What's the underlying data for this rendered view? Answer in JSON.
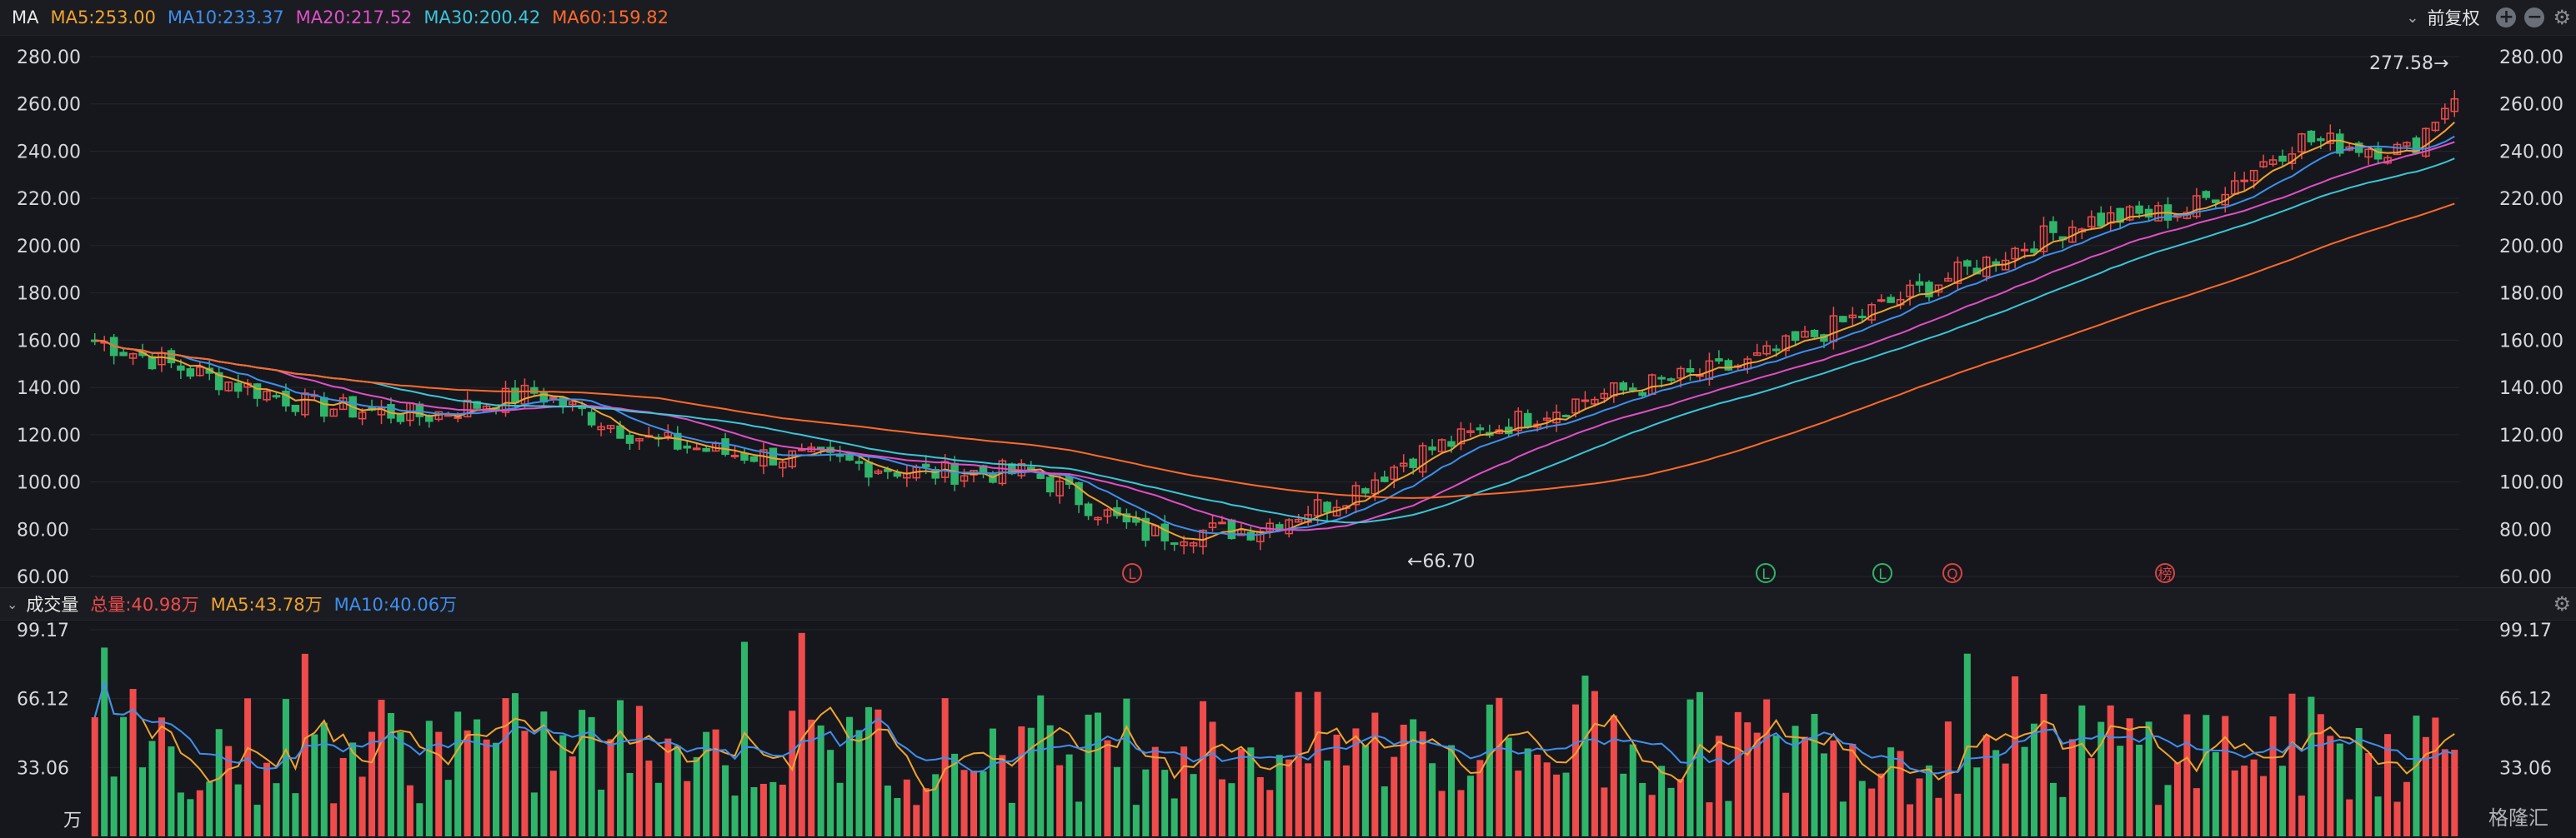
{
  "header": {
    "indicator": "MA",
    "ma": [
      {
        "label": "MA5:253.00",
        "color": "#f0a330"
      },
      {
        "label": "MA10:233.37",
        "color": "#3d8ff0"
      },
      {
        "label": "MA20:217.52",
        "color": "#e04fc8"
      },
      {
        "label": "MA30:200.42",
        "color": "#3bc5d9"
      },
      {
        "label": "MA60:159.82",
        "color": "#ff6a2a"
      }
    ],
    "adjust_label": "前复权",
    "chevron": "chevron-down-icon",
    "plus": "plus-circle-icon",
    "minus": "minus-circle-icon",
    "settings": "gear-icon"
  },
  "volume_header": {
    "title": "成交量",
    "items": [
      {
        "label": "总量:40.98万",
        "color": "#ef4b4b"
      },
      {
        "label": "MA5:43.78万",
        "color": "#f0a330"
      },
      {
        "label": "MA10:40.06万",
        "color": "#3d8ff0"
      }
    ]
  },
  "chart_data": [
    {
      "type": "candlestick",
      "ylim": [
        60,
        280
      ],
      "yticks": [
        "280.00",
        "260.00",
        "240.00",
        "220.00",
        "200.00",
        "180.00",
        "160.00",
        "140.00",
        "120.00",
        "100.00",
        "80.00",
        "60.00"
      ],
      "high_label": "277.58→",
      "low_label": "←66.70",
      "markers": [
        "L",
        "L",
        "L",
        "Q",
        "榜"
      ],
      "colors": {
        "up": "#ef4b4b",
        "down": "#2fb56a"
      }
    },
    {
      "type": "bar",
      "yticks": [
        "99.17",
        "66.12",
        "33.06"
      ],
      "unit": "万"
    }
  ],
  "watermark": "格隆汇"
}
